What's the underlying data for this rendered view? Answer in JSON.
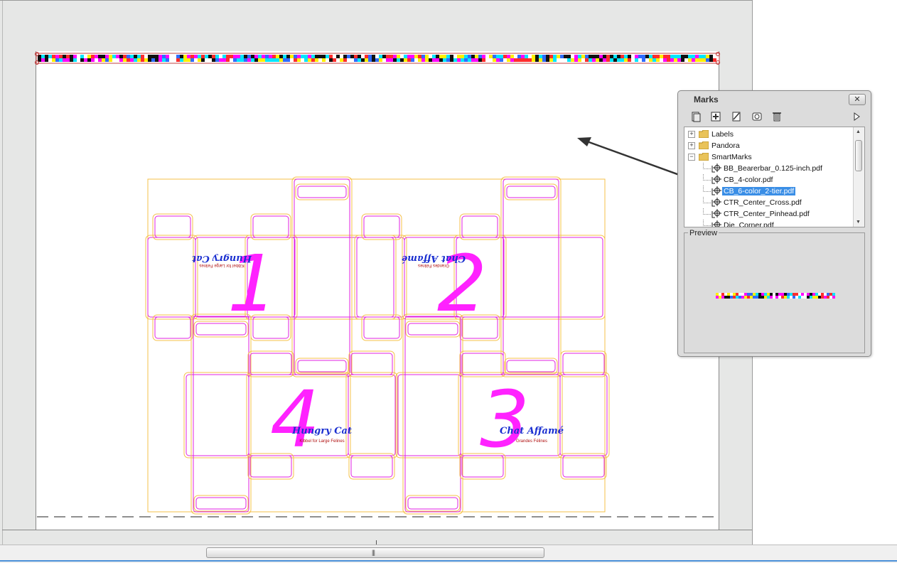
{
  "panel": {
    "title": "Marks",
    "preview_label": "Preview",
    "tree": [
      {
        "label": "Labels",
        "kind": "folder",
        "expander": "+"
      },
      {
        "label": "Pandora",
        "kind": "folder",
        "expander": "+"
      },
      {
        "label": "SmartMarks",
        "kind": "folder",
        "expander": "−"
      },
      {
        "label": "BB_Bearerbar_0.125-inch.pdf",
        "kind": "mark"
      },
      {
        "label": "CB_4-color.pdf",
        "kind": "mark"
      },
      {
        "label": "CB_6-color_2-tier.pdf",
        "kind": "mark",
        "selected": true
      },
      {
        "label": "CTR_Center_Cross.pdf",
        "kind": "mark"
      },
      {
        "label": "CTR_Center_Pinhead.pdf",
        "kind": "mark"
      },
      {
        "label": "Die_Corner.pdf",
        "kind": "mark"
      }
    ],
    "toolbar": [
      "add-mark-icon",
      "new-folder-icon",
      "edit-mark-icon",
      "refresh-icon",
      "delete-icon",
      "menu-arrow-icon"
    ]
  },
  "cartons": [
    {
      "number": "1",
      "brand": "Hungry Cat",
      "tagline": "Kibbel for Large Felines",
      "flipped": true
    },
    {
      "number": "2",
      "brand": "Chat Affamé",
      "tagline": "Grandes Félines",
      "flipped": true
    },
    {
      "number": "3",
      "brand": "Chat Affamé",
      "tagline": "Grandes Félines",
      "flipped": false
    },
    {
      "number": "4",
      "brand": "Hungry Cat",
      "tagline": "Kibbel for Large Felines",
      "flipped": false
    }
  ],
  "colors": {
    "die_line": "#e020e0",
    "bleed_line": "#f5c04a",
    "number": "#ff22ff",
    "brand": "#1a2fd0",
    "tagline": "#b01010",
    "selection": "#3a8ee6"
  },
  "colorbar_palette": [
    "#00e5ff",
    "#ff00ff",
    "#ffef00",
    "#111111",
    "#ff2d2d",
    "#2f6bff",
    "#ffffff"
  ]
}
